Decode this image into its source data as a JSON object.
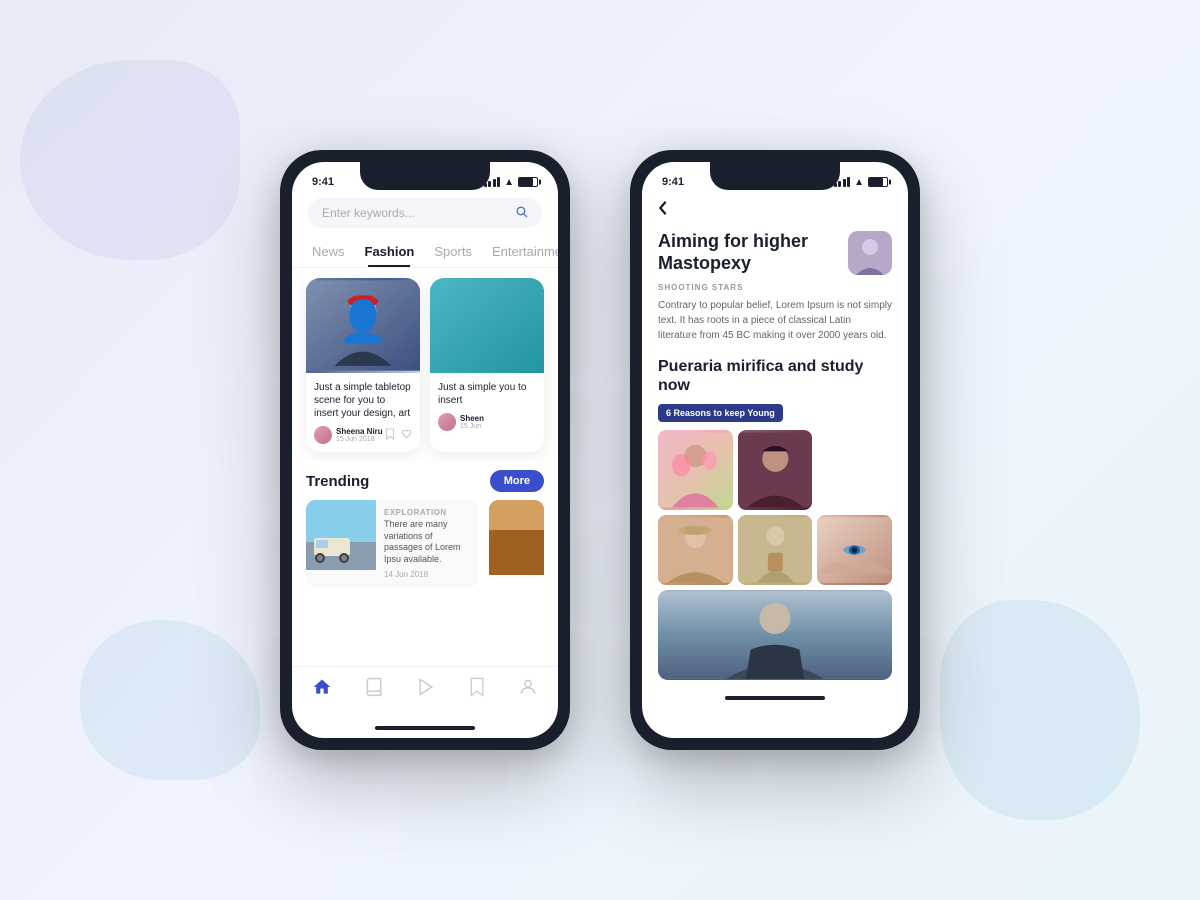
{
  "background": {
    "color": "#eef1fa"
  },
  "phone1": {
    "status_bar": {
      "time": "9:41",
      "battery": "75"
    },
    "search": {
      "placeholder": "Enter keywords..."
    },
    "tabs": [
      {
        "id": "news",
        "label": "News",
        "active": false
      },
      {
        "id": "fashion",
        "label": "Fashion",
        "active": true
      },
      {
        "id": "sports",
        "label": "Sports",
        "active": false
      },
      {
        "id": "entertainment",
        "label": "Entertainment",
        "active": false
      }
    ],
    "articles": [
      {
        "title": "Just a simple tabletop scene for you to insert your design, art",
        "author": "Sheena Niru",
        "date": "15 Jun 2018"
      },
      {
        "title": "Just a simple you to insert",
        "author": "Sheen",
        "date": "15 Jun"
      }
    ],
    "trending": {
      "label": "Trending",
      "more_button": "More",
      "items": [
        {
          "category": "EXPLORATION",
          "description": "There are many variations of passages of Lorem Ipsu available.",
          "date": "14 Jun 2018"
        }
      ]
    },
    "bottom_nav": [
      {
        "id": "home",
        "label": "Home",
        "active": true
      },
      {
        "id": "book",
        "label": "Book",
        "active": false
      },
      {
        "id": "play",
        "label": "Play",
        "active": false
      },
      {
        "id": "bookmark",
        "label": "Bookmark",
        "active": false
      },
      {
        "id": "profile",
        "label": "Profile",
        "active": false
      }
    ]
  },
  "phone2": {
    "status_bar": {
      "time": "9:41"
    },
    "back_button": "<",
    "article": {
      "title": "Aiming for higher Mastopexy",
      "subtitle": "SHOOTING STARS",
      "body": "Contrary to popular belief, Lorem Ipsum is not simply text. It has roots in a piece of classical Latin literature from 45 BC making it over 2000 years old.",
      "section_title": "Pueraria mirifica and study now",
      "tag": "6 Reasons to keep Young"
    }
  }
}
